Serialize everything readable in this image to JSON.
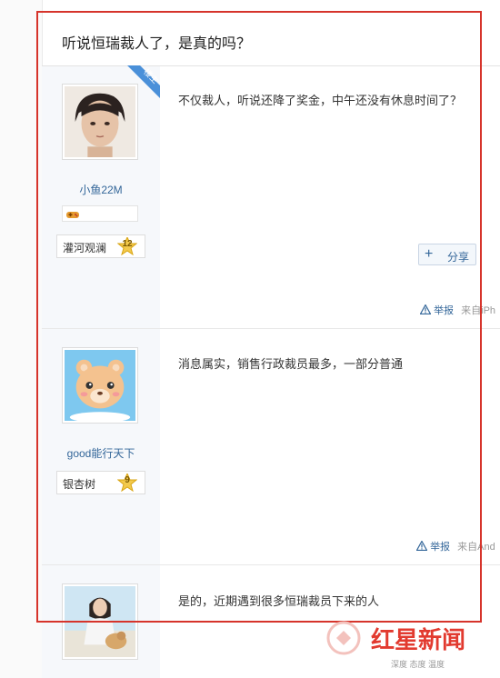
{
  "thread": {
    "title": "听说恒瑞裁人了，是真的吗？"
  },
  "posts": [
    {
      "username": "小鱼22M",
      "level_title": "灌河观澜",
      "level_num": "12",
      "ribbon": "楼主",
      "content": "不仅裁人，听说还降了奖金，中午还没有休息时间了？",
      "share_label": "分享",
      "report_label": "举报",
      "source": "来自iPh"
    },
    {
      "username": "good能行天下",
      "level_title": "银杏树",
      "level_num": "9",
      "content": "消息属实，销售行政裁员最多，一部分普通",
      "report_label": "举报",
      "source": "来自And"
    },
    {
      "content": "是的，近期遇到很多恒瑞裁员下来的人"
    }
  ],
  "watermark": {
    "name": "红星新闻",
    "slogan": "深度 态度 温度"
  },
  "colors": {
    "highlight_frame": "#d6342b",
    "link": "#336699",
    "ribbon": "#4a90d9",
    "watermark": "#e23a2f"
  },
  "icons": [
    "warning-icon",
    "plus-icon",
    "star-badge-icon",
    "game-controller-icon"
  ]
}
